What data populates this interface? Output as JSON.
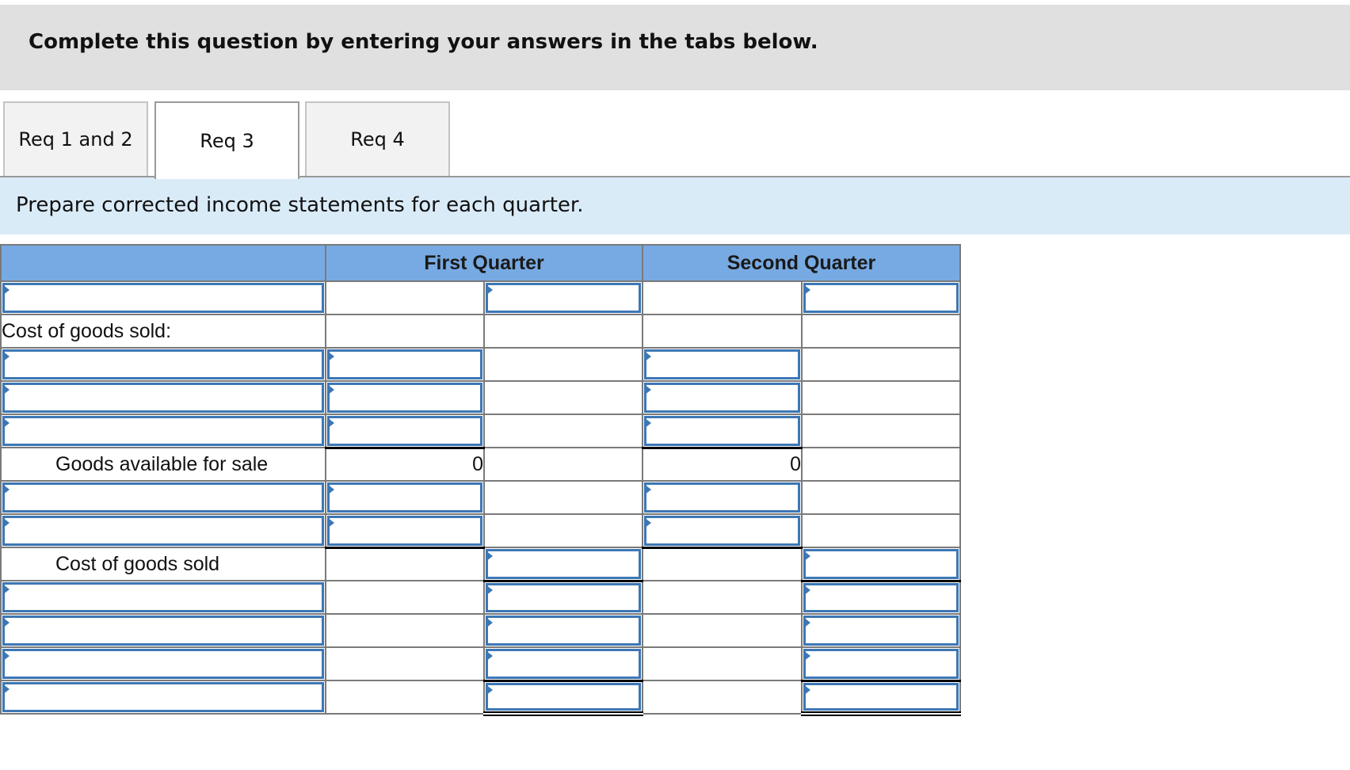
{
  "banner": {
    "text": "Complete this question by entering your answers in the tabs below."
  },
  "tabs": [
    {
      "label": "Req 1 and 2",
      "active": false
    },
    {
      "label": "Req 3",
      "active": true
    },
    {
      "label": "Req 4",
      "active": false
    }
  ],
  "instruction": "Prepare corrected income statements for each quarter.",
  "table": {
    "headers": {
      "label_col": "",
      "q1": "First Quarter",
      "q2": "Second Quarter"
    },
    "rows": [
      {
        "label": "",
        "label_input": true,
        "q1a": null,
        "q1b": "input",
        "q2a": null,
        "q2b": "input"
      },
      {
        "label": "Cost of goods sold:",
        "label_input": false
      },
      {
        "label": "",
        "label_input": true,
        "q1a": "input",
        "q2a": "input"
      },
      {
        "label": "",
        "label_input": true,
        "q1a": "input",
        "q2a": "input"
      },
      {
        "label": "",
        "label_input": true,
        "q1a": "input",
        "q2a": "input"
      },
      {
        "label": "Goods available for sale",
        "label_input": false,
        "q1a": "0",
        "q2a": "0"
      },
      {
        "label": "",
        "label_input": true,
        "q1a": "input",
        "q2a": "input"
      },
      {
        "label": "",
        "label_input": true,
        "q1a": "input",
        "q2a": "input"
      },
      {
        "label": "Cost of goods sold",
        "label_input": false,
        "q1b": "input",
        "q2b": "input"
      },
      {
        "label": "",
        "label_input": true,
        "q1b": "input",
        "q2b": "input"
      },
      {
        "label": "",
        "label_input": true,
        "q1b": "input",
        "q2b": "input"
      },
      {
        "label": "",
        "label_input": true,
        "q1b": "input",
        "q2b": "input"
      },
      {
        "label": "",
        "label_input": true,
        "q1b": "input",
        "q2b": "input"
      }
    ],
    "gas_q1": "0",
    "gas_q2": "0",
    "row2_label": "Cost of goods sold:",
    "row6_label": "Goods available for sale",
    "row9_label": "Cost of goods sold"
  }
}
